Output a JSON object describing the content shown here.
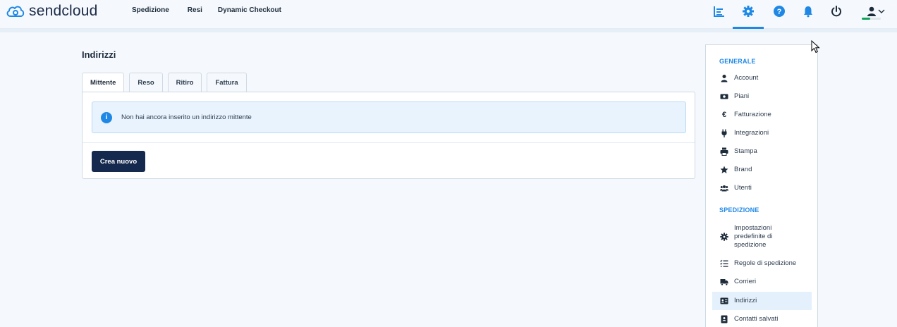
{
  "brand": {
    "name": "sendcloud",
    "primary": "#15294e",
    "accent": "#1f88e5"
  },
  "nav": [
    {
      "label": "Spedizione"
    },
    {
      "label": "Resi"
    },
    {
      "label": "Dynamic Checkout"
    }
  ],
  "top_icons": [
    "analytics-icon",
    "settings-icon",
    "help-icon",
    "bell-icon",
    "power-icon",
    "user-icon"
  ],
  "user": {
    "status_fraction": 0.45,
    "status_color": "#12a35a"
  },
  "page": {
    "title": "Indirizzi"
  },
  "tabs": [
    {
      "label": "Mittente",
      "active": true
    },
    {
      "label": "Reso"
    },
    {
      "label": "Ritiro"
    },
    {
      "label": "Fattura"
    }
  ],
  "notice": {
    "text": "Non hai ancora inserito un indirizzo mittente"
  },
  "actions": {
    "create_label": "Crea nuovo"
  },
  "sidebar": {
    "general_heading": "GENERALE",
    "general_items": [
      {
        "label": "Account",
        "icon": "user-icon"
      },
      {
        "label": "Piani",
        "icon": "money-icon"
      },
      {
        "label": "Fatturazione",
        "icon": "euro-icon"
      },
      {
        "label": "Integrazioni",
        "icon": "plug-icon"
      },
      {
        "label": "Stampa",
        "icon": "printer-icon"
      },
      {
        "label": "Brand",
        "icon": "star-icon"
      },
      {
        "label": "Utenti",
        "icon": "users-icon"
      }
    ],
    "shipping_heading": "SPEDIZIONE",
    "shipping_items": [
      {
        "label": "Impostazioni predefinite di spedizione",
        "icon": "gear-icon"
      },
      {
        "label": "Regole di spedizione",
        "icon": "checklist-icon"
      },
      {
        "label": "Corrieri",
        "icon": "truck-icon"
      },
      {
        "label": "Indirizzi",
        "icon": "address-card-icon",
        "active": true
      },
      {
        "label": "Contatti salvati",
        "icon": "contact-book-icon"
      }
    ]
  }
}
